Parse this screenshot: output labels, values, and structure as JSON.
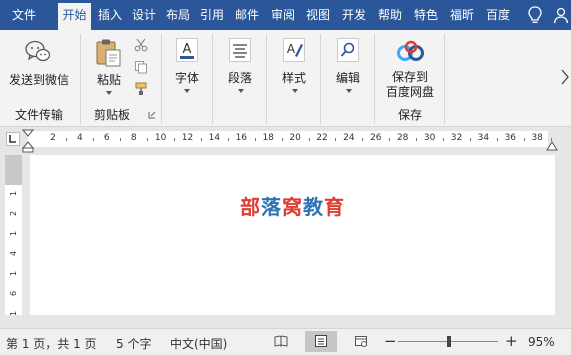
{
  "tabs": [
    {
      "label": "文件"
    },
    {
      "label": "开始"
    },
    {
      "label": "插入"
    },
    {
      "label": "设计"
    },
    {
      "label": "布局"
    },
    {
      "label": "引用"
    },
    {
      "label": "邮件"
    },
    {
      "label": "审阅"
    },
    {
      "label": "视图"
    },
    {
      "label": "开发"
    },
    {
      "label": "帮助"
    },
    {
      "label": "特色"
    },
    {
      "label": "福昕"
    },
    {
      "label": "百度"
    }
  ],
  "selected_tab": "开始",
  "ribbon": {
    "send_to_wechat": "发送到微信",
    "group_file_transfer": "文件传输",
    "paste": "粘贴",
    "group_clipboard": "剪贴板",
    "font": "字体",
    "paragraph": "段落",
    "styles": "样式",
    "editing": "编辑",
    "save_to_line1": "保存到",
    "save_to_line2": "百度网盘",
    "group_save": "保存"
  },
  "ruler_numbers": [
    "2",
    "4",
    "6",
    "8",
    "10",
    "12",
    "14",
    "16",
    "18",
    "20",
    "22",
    "24",
    "26",
    "28",
    "30",
    "32",
    "34",
    "36",
    "38"
  ],
  "vruler_numbers": [
    "1",
    "2",
    "1",
    "4",
    "1",
    "6",
    "1"
  ],
  "document": {
    "chars": [
      {
        "ch": "部",
        "color": "#e03c31"
      },
      {
        "ch": "落",
        "color": "#2e74b5"
      },
      {
        "ch": "窝",
        "color": "#e03c31"
      },
      {
        "ch": "教",
        "color": "#2e74b5"
      },
      {
        "ch": "育",
        "color": "#e03c31"
      }
    ]
  },
  "status": {
    "page": "第 1 页，共 1 页",
    "words": "5 个字",
    "language": "中文(中国)",
    "zoom_minus": "−",
    "zoom_plus": "+",
    "zoom": "95%"
  },
  "colors": {
    "tabbar": "#2b579a",
    "ribbon": "#f3f3f3"
  }
}
